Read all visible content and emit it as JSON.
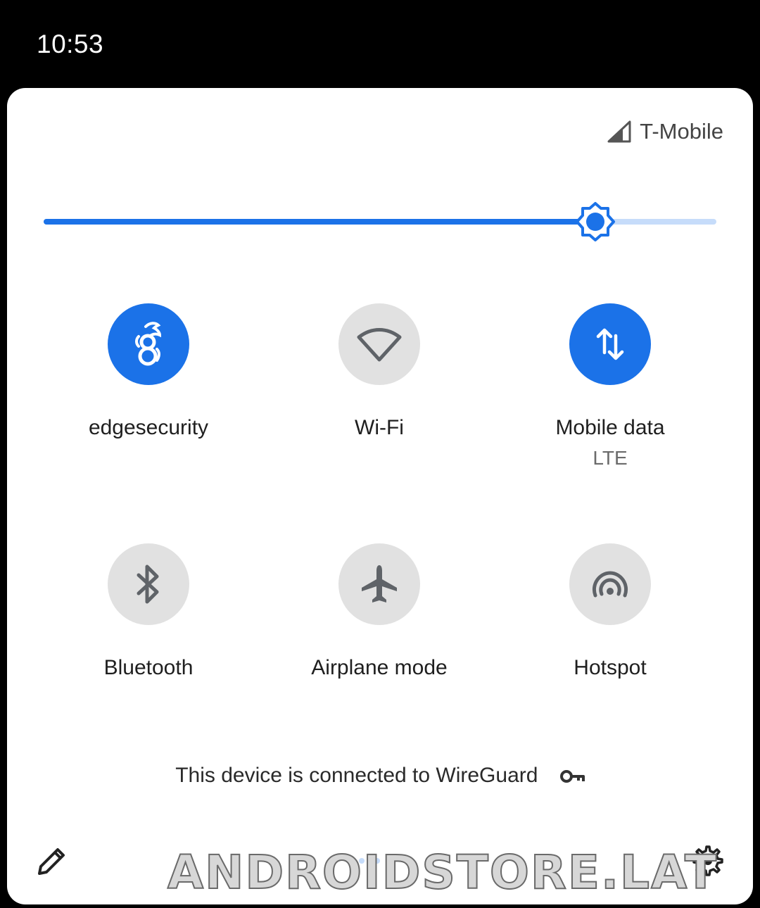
{
  "status_bar": {
    "time": "10:53"
  },
  "header": {
    "carrier": "T-Mobile",
    "carrier_icon": "signal-icon"
  },
  "brightness": {
    "level": 0.82
  },
  "tiles": [
    {
      "label": "edgesecurity",
      "icon": "wireguard-icon",
      "state": "on"
    },
    {
      "label": "Wi-Fi",
      "icon": "wifi-icon",
      "state": "off"
    },
    {
      "label": "Mobile data",
      "sublabel": "LTE",
      "icon": "mobile-data-icon",
      "state": "on"
    },
    {
      "label": "Bluetooth",
      "icon": "bluetooth-icon",
      "state": "off"
    },
    {
      "label": "Airplane mode",
      "icon": "airplane-icon",
      "state": "off"
    },
    {
      "label": "Hotspot",
      "icon": "hotspot-icon",
      "state": "off"
    }
  ],
  "footer": {
    "vpn_message": "This device is connected to WireGuard",
    "vpn_icon": "key-icon",
    "edit_icon": "pencil-icon",
    "settings_icon": "gear-icon"
  },
  "watermark": "ANDROIDSTORE.LAT",
  "colors": {
    "accent": "#1b72e8",
    "accent_light": "#c6dcfa",
    "tile_off": "#e1e1e1",
    "icon_off": "#5f6368"
  }
}
